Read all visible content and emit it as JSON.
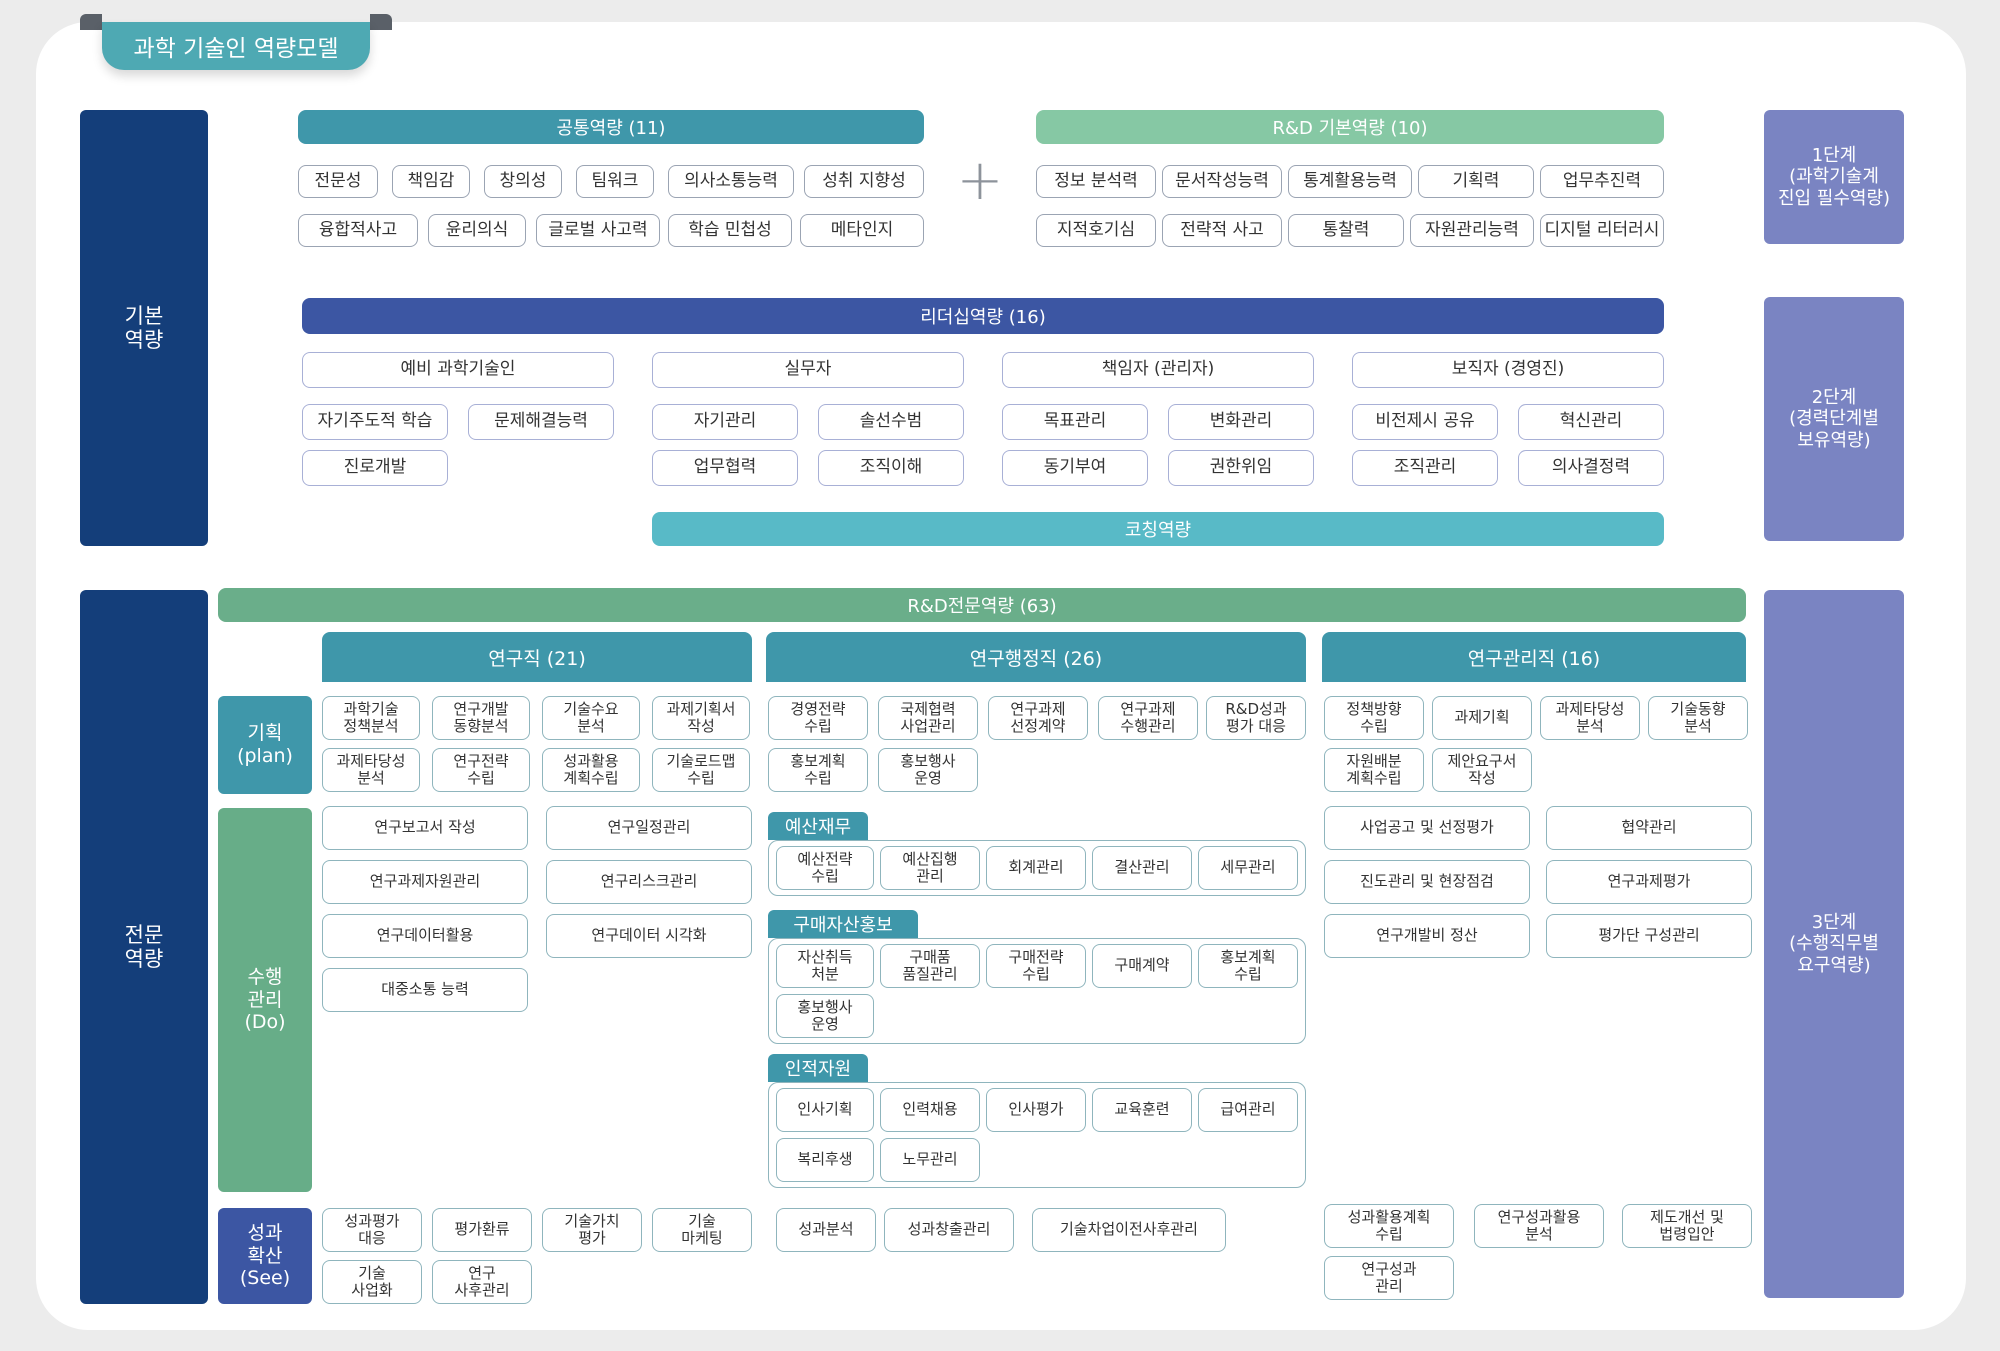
{
  "title": "과학 기술인 역량모델",
  "side_basic": "기본\n역량",
  "side_expert": "전문\n역량",
  "stage1": "1단계\n(과학기술계\n진입 필수역량)",
  "stage2": "2단계\n(경력단계별\n보유역량)",
  "stage3": "3단계\n(수행직무별\n요구역량)",
  "common": {
    "header": "공통역량 (11)",
    "items": [
      "전문성",
      "책임감",
      "창의성",
      "팀워크",
      "의사소통능력",
      "성취 지향성",
      "융합적사고",
      "윤리의식",
      "글로벌 사고력",
      "학습 민첩성",
      "메타인지"
    ]
  },
  "plus": "+",
  "rnd_basic": {
    "header": "R&D 기본역량 (10)",
    "items": [
      "정보 분석력",
      "문서작성능력",
      "통계활용능력",
      "기획력",
      "업무추진력",
      "지적호기심",
      "전략적 사고",
      "통찰력",
      "자원관리능력",
      "디지털 리터러시"
    ]
  },
  "leadership": {
    "header": "리더십역량 (16)",
    "groups": [
      {
        "title": "예비 과학기술인",
        "items": [
          "자기주도적 학습",
          "문제해결능력",
          "진로개발"
        ]
      },
      {
        "title": "실무자",
        "items": [
          "자기관리",
          "솔선수범",
          "업무협력",
          "조직이해"
        ]
      },
      {
        "title": "책임자 (관리자)",
        "items": [
          "목표관리",
          "변화관리",
          "동기부여",
          "권한위임"
        ]
      },
      {
        "title": "보직자 (경영진)",
        "items": [
          "비전제시 공유",
          "혁신관리",
          "조직관리",
          "의사결정력"
        ]
      }
    ],
    "coaching": "코칭역량"
  },
  "expert": {
    "header": "R&D전문역량 (63)",
    "tabs": [
      "연구직 (21)",
      "연구행정직 (26)",
      "연구관리직 (16)"
    ],
    "phases": [
      "기획\n(plan)",
      "수행\n관리\n(Do)",
      "성과\n확산\n(See)"
    ],
    "research_plan": [
      "과학기술\n정책분석",
      "연구개발\n동향분석",
      "기술수요\n분석",
      "과제기획서\n작성",
      "과제타당성\n분석",
      "연구전략\n수립",
      "성과활용\n계획수립",
      "기술로드맵\n수립"
    ],
    "research_do": [
      "연구보고서 작성",
      "연구일정관리",
      "연구과제자원관리",
      "연구리스크관리",
      "연구데이터활용",
      "연구데이터 시각화",
      "대중소통 능력"
    ],
    "research_see": [
      "성과평가\n대응",
      "평가환류",
      "기술가치\n평가",
      "기술\n마케팅",
      "기술\n사업화",
      "연구\n사후관리"
    ],
    "admin_plan": [
      "경영전략\n수립",
      "국제협력\n사업관리",
      "연구과제\n선정계약",
      "연구과제\n수행관리",
      "R&D성과\n평가 대응",
      "홍보계획\n수립",
      "홍보행사\n운영"
    ],
    "budget": {
      "label": "예산재무",
      "items": [
        "예산전략\n수립",
        "예산집행\n관리",
        "회계관리",
        "결산관리",
        "세무관리"
      ]
    },
    "purchase": {
      "label": "구매자산홍보",
      "items": [
        "자산취득\n처분",
        "구매품\n품질관리",
        "구매전략\n수립",
        "구매계약",
        "홍보계획\n수립",
        "홍보행사\n운영"
      ]
    },
    "hr": {
      "label": "인적자원",
      "items": [
        "인사기획",
        "인력채용",
        "인사평가",
        "교육훈련",
        "급여관리",
        "복리후생",
        "노무관리"
      ]
    },
    "admin_see": [
      "성과분석",
      "성과창출관리",
      "기술차업이전사후관리"
    ],
    "mgmt_plan": [
      "정책방향\n수립",
      "과제기획",
      "과제타당성\n분석",
      "기술동향\n분석",
      "자원배분\n계획수립",
      "제안요구서\n작성"
    ],
    "mgmt_do": [
      "사업공고 및 선정평가",
      "협약관리",
      "진도관리 및 현장점검",
      "연구과제평가",
      "연구개발비 정산",
      "평가단 구성관리"
    ],
    "mgmt_see": [
      "성과활용계획\n수립",
      "연구성과활용\n분석",
      "제도개선 및\n법령입안",
      "연구성과\n관리"
    ]
  },
  "colors": {
    "navy": "#143e7a",
    "lavender": "#7a84c2",
    "teal": "#3f97aa",
    "light_teal": "#56b8c6",
    "mint": "#7dc3a0",
    "green_bar": "#6aae8a",
    "blue": "#3c56a3",
    "do_green": "#67ad88"
  }
}
